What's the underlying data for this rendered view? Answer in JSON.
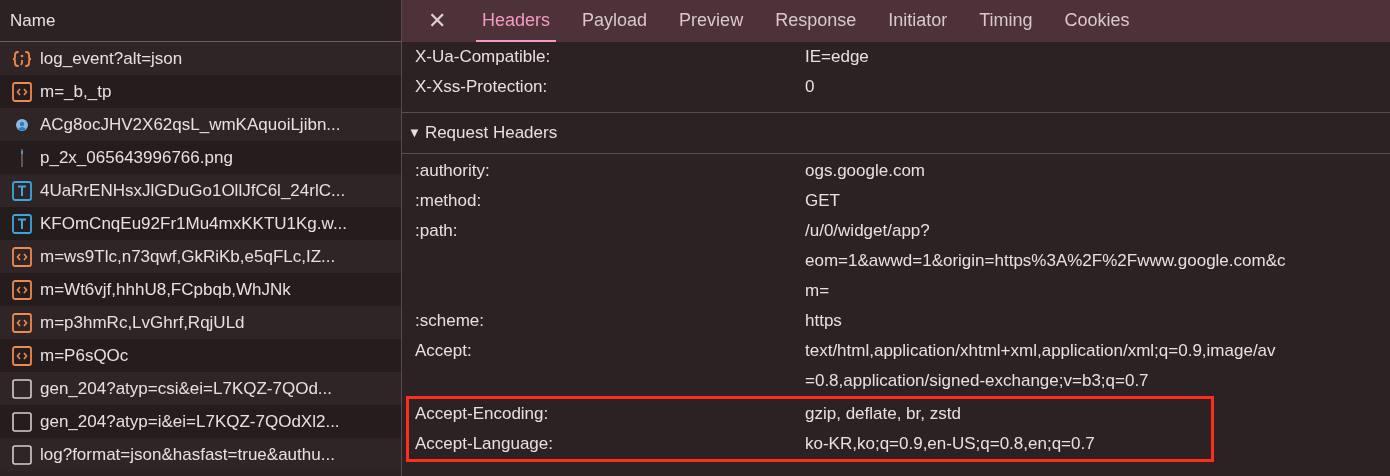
{
  "requests_panel": {
    "column_header": "Name",
    "requests": [
      {
        "name": "log_event?alt=json",
        "kind": "json"
      },
      {
        "name": "m=_b,_tp",
        "kind": "script"
      },
      {
        "name": "ACg8ocJHV2X62qsL_wmKAquoiLjibn...",
        "kind": "avatar"
      },
      {
        "name": "p_2x_065643996766.png",
        "kind": "image"
      },
      {
        "name": "4UaRrENHsxJlGDuGo1OllJfC6l_24rlC...",
        "kind": "font"
      },
      {
        "name": "KFOmCnqEu92Fr1Mu4mxKKTU1Kg.w...",
        "kind": "font"
      },
      {
        "name": "m=ws9Tlc,n73qwf,GkRiKb,e5qFLc,IZ...",
        "kind": "script"
      },
      {
        "name": "m=Wt6vjf,hhhU8,FCpbqb,WhJNk",
        "kind": "script"
      },
      {
        "name": "m=p3hmRc,LvGhrf,RqjULd",
        "kind": "script"
      },
      {
        "name": "m=P6sQOc",
        "kind": "script"
      },
      {
        "name": "gen_204?atyp=csi&ei=L7KQZ-7QOd...",
        "kind": "document"
      },
      {
        "name": "gen_204?atyp=i&ei=L7KQZ-7QOdXl2...",
        "kind": "document"
      },
      {
        "name": "log?format=json&hasfast=true&authu...",
        "kind": "document"
      }
    ]
  },
  "details_panel": {
    "close": "✕",
    "tabs": [
      {
        "label": "Headers",
        "selected": true
      },
      {
        "label": "Payload",
        "selected": false
      },
      {
        "label": "Preview",
        "selected": false
      },
      {
        "label": "Response",
        "selected": false
      },
      {
        "label": "Initiator",
        "selected": false
      },
      {
        "label": "Timing",
        "selected": false
      },
      {
        "label": "Cookies",
        "selected": false
      }
    ],
    "response_headers": [
      {
        "name": "X-Ua-Compatible:",
        "value_lines": [
          "IE=edge"
        ]
      },
      {
        "name": "X-Xss-Protection:",
        "value_lines": [
          "0"
        ]
      }
    ],
    "request_section": {
      "title": "Request Headers",
      "expanded": true,
      "toggle": "▼"
    },
    "request_headers": [
      {
        "name": ":authority:",
        "value_lines": [
          "ogs.google.com"
        ],
        "highlighted": false
      },
      {
        "name": ":method:",
        "value_lines": [
          "GET"
        ],
        "highlighted": false
      },
      {
        "name": ":path:",
        "value_lines": [
          "/u/0/widget/app?",
          "eom=1&awwd=1&origin=https%3A%2F%2Fwww.google.com&c",
          "m="
        ],
        "highlighted": false
      },
      {
        "name": ":scheme:",
        "value_lines": [
          "https"
        ],
        "highlighted": false
      },
      {
        "name": "Accept:",
        "value_lines": [
          "text/html,application/xhtml+xml,application/xml;q=0.9,image/av",
          "=0.8,application/signed-exchange;v=b3;q=0.7"
        ],
        "highlighted": false
      },
      {
        "name": "Accept-Encoding:",
        "value_lines": [
          "gzip, deflate, br, zstd"
        ],
        "highlighted": true
      },
      {
        "name": "Accept-Language:",
        "value_lines": [
          "ko-KR,ko;q=0.9,en-US;q=0.8,en;q=0.7"
        ],
        "highlighted": true
      }
    ]
  }
}
